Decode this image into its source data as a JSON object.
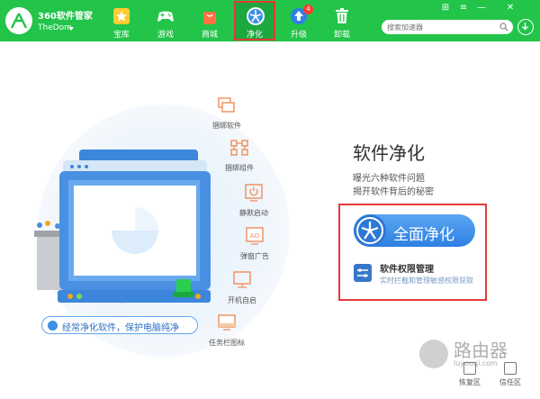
{
  "app": {
    "title": "360软件管家",
    "user": "TheDom"
  },
  "nav": [
    {
      "label": "宝库",
      "icon": "star-icon"
    },
    {
      "label": "游戏",
      "icon": "gamepad-icon"
    },
    {
      "label": "商城",
      "icon": "shopping-bag-icon"
    },
    {
      "label": "净化",
      "icon": "fan-icon",
      "active": true
    },
    {
      "label": "升级",
      "icon": "upload-arrow-icon",
      "badge": "4"
    },
    {
      "label": "卸载",
      "icon": "trash-icon"
    }
  ],
  "window_controls": [
    "⊞",
    "≡",
    "—",
    "✕"
  ],
  "search": {
    "placeholder": "搜索加速器"
  },
  "features": [
    {
      "label": "捆绑软件",
      "icon": "bundled-software-icon"
    },
    {
      "label": "捆绑组件",
      "icon": "bundled-component-icon"
    },
    {
      "label": "静默启动",
      "icon": "silent-startup-icon"
    },
    {
      "label": "弹窗广告",
      "icon": "popup-ad-icon"
    },
    {
      "label": "开机自启",
      "icon": "autostart-icon"
    },
    {
      "label": "任务栏图标",
      "icon": "taskbar-icon"
    }
  ],
  "popup_ad_badge": "AD",
  "tip": "经常净化软件，保护电脑纯净",
  "panel": {
    "title": "软件净化",
    "desc_line1": "曝光六种软件问题",
    "desc_line2": "揭开软件背后的秘密",
    "clean_button": "全面净化",
    "perm_title": "软件权限管理",
    "perm_desc": "实时拦截和管理敏感权限获取"
  },
  "bottom": {
    "restore": "恢复区",
    "trust": "信任区"
  },
  "watermark": {
    "title": "路由器",
    "sub": "luyouqi.com"
  },
  "colors": {
    "brand_green": "#22c449",
    "accent_blue": "#2f80e2",
    "highlight_red": "#e53935"
  }
}
